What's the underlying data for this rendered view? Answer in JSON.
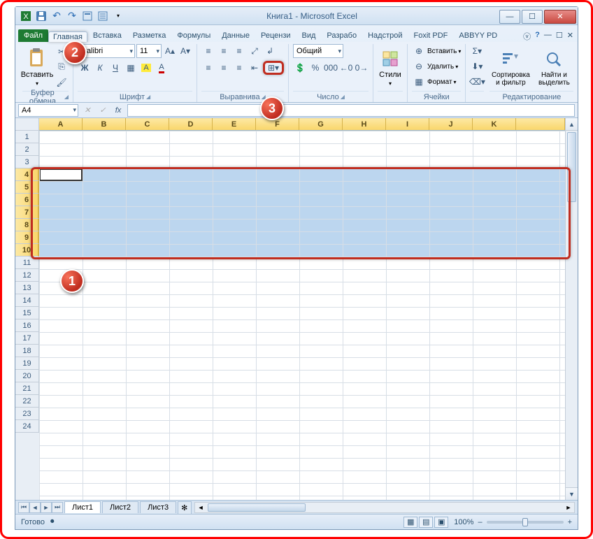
{
  "title": "Книга1 - Microsoft Excel",
  "qat": {
    "save": "💾",
    "undo": "↶",
    "redo": "↷"
  },
  "tabs": {
    "file": "Файл",
    "home": "Главная",
    "insert": "Вставка",
    "layout": "Разметка",
    "formulas": "Формулы",
    "data": "Данные",
    "review": "Рецензи",
    "view": "Вид",
    "dev": "Разрабо",
    "addins": "Надстрой",
    "foxit": "Foxit PDF",
    "abbyy": "ABBYY PD"
  },
  "ribbon": {
    "clipboard": {
      "paste": "Вставить",
      "label": "Буфер обмена"
    },
    "font": {
      "name": "Calibri",
      "size": "11",
      "label": "Шрифт",
      "bold": "Ж",
      "italic": "К",
      "underline": "Ч"
    },
    "align": {
      "label": "Выравнива"
    },
    "number": {
      "format": "Общий",
      "label": "Число"
    },
    "styles": {
      "btn": "Стили"
    },
    "cells": {
      "insert": "Вставить",
      "delete": "Удалить",
      "format": "Формат",
      "label": "Ячейки"
    },
    "editing": {
      "sort": "Сортировка и фильтр",
      "find": "Найти и выделить",
      "label": "Редактирование"
    }
  },
  "namebox": "A4",
  "fx": "fx",
  "columns": [
    "A",
    "B",
    "C",
    "D",
    "E",
    "F",
    "G",
    "H",
    "I",
    "J",
    "K"
  ],
  "rows": [
    "1",
    "2",
    "3",
    "4",
    "5",
    "6",
    "7",
    "8",
    "9",
    "10",
    "11",
    "12",
    "13",
    "14",
    "15",
    "16",
    "17",
    "18",
    "19",
    "20",
    "21",
    "22",
    "23",
    "24"
  ],
  "sheets": {
    "s1": "Лист1",
    "s2": "Лист2",
    "s3": "Лист3"
  },
  "status": {
    "ready": "Готово",
    "zoom": "100%"
  },
  "badges": {
    "b1": "1",
    "b2": "2",
    "b3": "3"
  },
  "icons": {
    "help": "?",
    "min": "—",
    "max": "☐",
    "close": "✕",
    "up": "▲",
    "down": "▼",
    "left": "◄",
    "right": "►",
    "minus": "–",
    "plus": "+"
  }
}
